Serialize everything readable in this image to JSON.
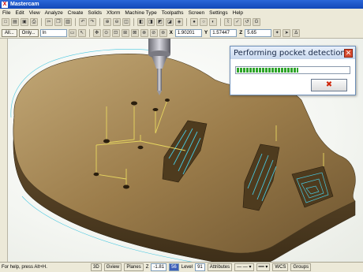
{
  "window": {
    "title": "Mastercam"
  },
  "menu": [
    "File",
    "Edit",
    "View",
    "Analyze",
    "Create",
    "Solids",
    "Xform",
    "Machine Type",
    "Toolpaths",
    "Screen",
    "Settings",
    "Help"
  ],
  "toolbar": {
    "all_label": "All...",
    "only_label": "Only...",
    "units_value": "In",
    "x_label": "X",
    "x_value": "1.90201",
    "y_label": "Y",
    "y_value": "1.57447",
    "z_label": "Z",
    "z_value": "5.65"
  },
  "dialog": {
    "title": "Performing pocket detection.",
    "progress_fraction": 0.55
  },
  "status": {
    "help_text": "For help, press Alt+H.",
    "view_3d": "3D",
    "gview": "Gview",
    "planes": "Planes",
    "z_label": "Z",
    "z_value": "-1.81",
    "color_value": "56",
    "level_label": "Level",
    "level_value": "91",
    "attributes": "Attributes",
    "wcs": "WCS",
    "groups": "Groups"
  },
  "colors": {
    "title_bar": "#1a56cc",
    "guitar_body": "#9a7a4a",
    "toolpath": "#e8d860",
    "pocket_path": "#48c8e0",
    "progress": "#2fa52a"
  }
}
